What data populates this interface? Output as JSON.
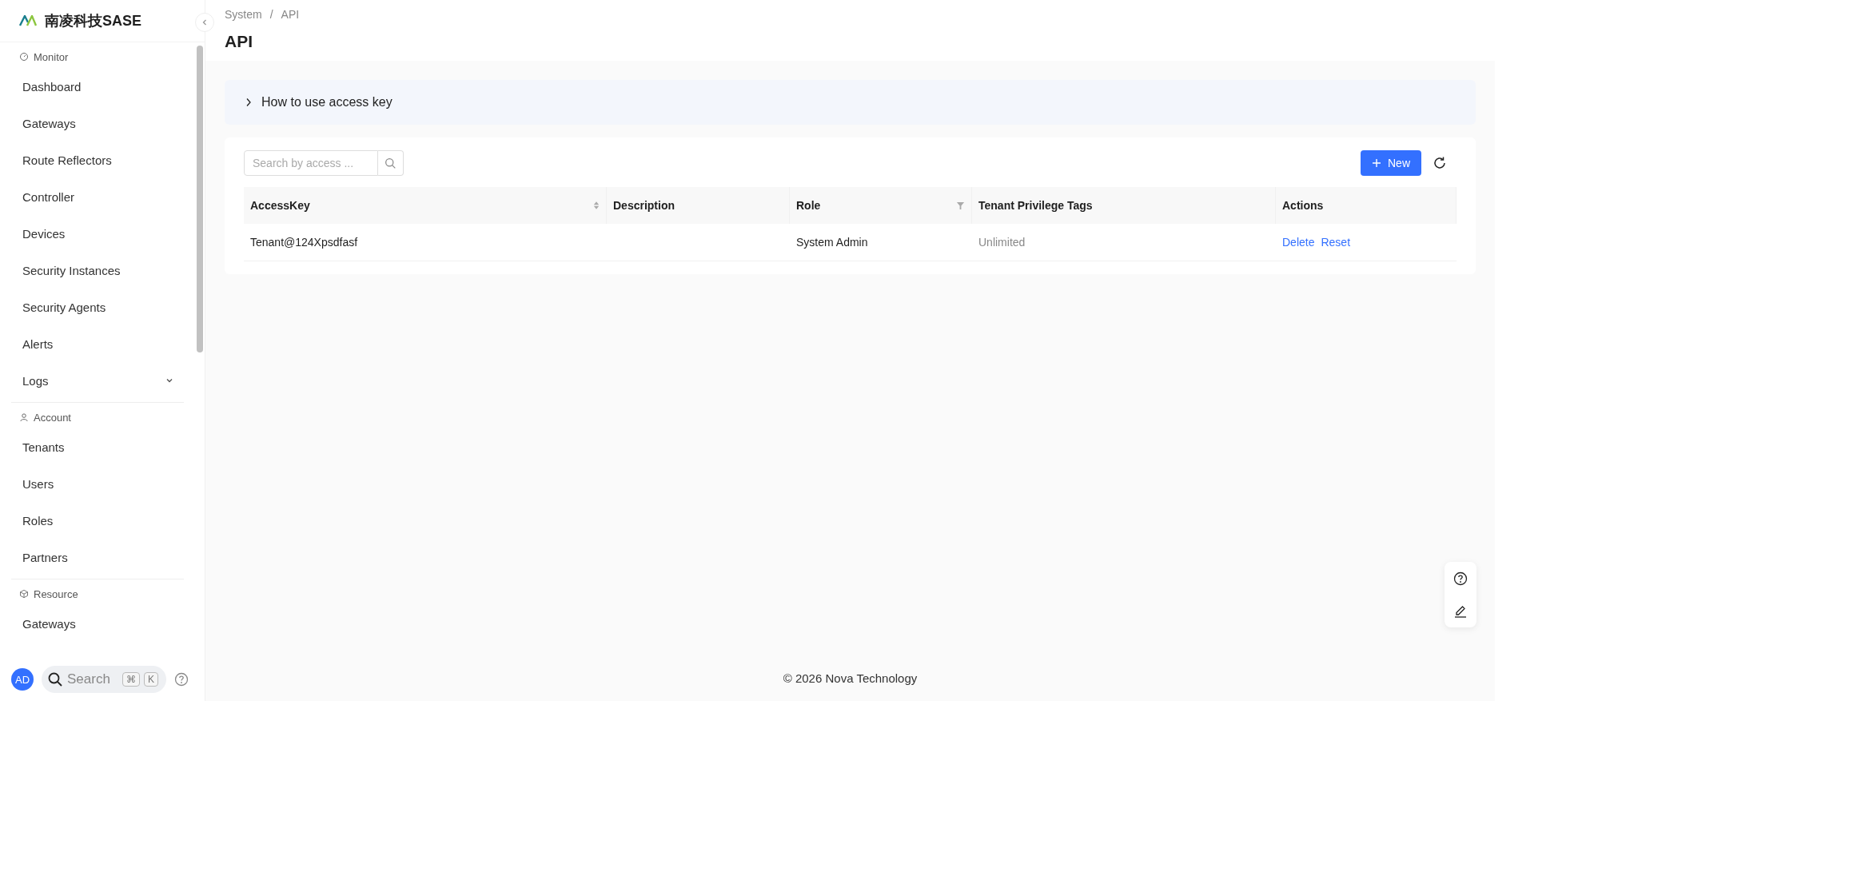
{
  "sidebar": {
    "brand": "南凌科技SASE",
    "sections": [
      {
        "title": "Monitor",
        "kind": "monitor",
        "items": [
          {
            "label": "Dashboard",
            "kind": "link"
          },
          {
            "label": "Gateways",
            "kind": "link"
          },
          {
            "label": "Route Reflectors",
            "kind": "link"
          },
          {
            "label": "Controller",
            "kind": "link"
          },
          {
            "label": "Devices",
            "kind": "link"
          },
          {
            "label": "Security Instances",
            "kind": "link"
          },
          {
            "label": "Security Agents",
            "kind": "link"
          },
          {
            "label": "Alerts",
            "kind": "link"
          },
          {
            "label": "Logs",
            "kind": "group"
          }
        ]
      },
      {
        "title": "Account",
        "kind": "account",
        "items": [
          {
            "label": "Tenants",
            "kind": "link"
          },
          {
            "label": "Users",
            "kind": "link"
          },
          {
            "label": "Roles",
            "kind": "link"
          },
          {
            "label": "Partners",
            "kind": "link"
          }
        ]
      },
      {
        "title": "Resource",
        "kind": "resource",
        "items": [
          {
            "label": "Gateways",
            "kind": "link"
          }
        ]
      }
    ],
    "user": {
      "initials": "AD"
    },
    "search": {
      "placeholder": "Search",
      "keys": [
        "⌘",
        "K"
      ]
    }
  },
  "breadcrumb": {
    "items": [
      "System",
      "API"
    ],
    "separator": "/"
  },
  "title": "API",
  "collapse": {
    "title": "How to use access key",
    "expanded": false
  },
  "table": {
    "search": {
      "placeholder": "Search by access ..."
    },
    "new_button": "New",
    "columns": [
      {
        "label": "AccessKey",
        "sortable": true,
        "filterable": false
      },
      {
        "label": "Description",
        "sortable": false,
        "filterable": false
      },
      {
        "label": "Role",
        "sortable": false,
        "filterable": true
      },
      {
        "label": "Tenant Privilege Tags",
        "sortable": false,
        "filterable": false
      },
      {
        "label": "Actions",
        "sortable": false,
        "filterable": false
      }
    ],
    "rows": [
      {
        "access_key": "Tenant@124Xpsdfasf",
        "role": "System Admin",
        "tags": "Unlimited",
        "actions": [
          "Delete",
          "Reset"
        ]
      }
    ]
  },
  "footer": "© 2026 Nova Technology"
}
